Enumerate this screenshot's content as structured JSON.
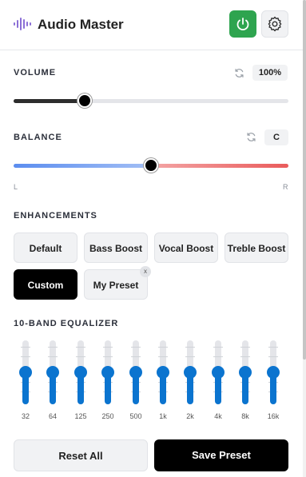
{
  "header": {
    "title": "Audio Master",
    "power_color": "#2ea44f"
  },
  "volume": {
    "label": "VOLUME",
    "value_text": "100%",
    "level": 0.26
  },
  "balance": {
    "label": "BALANCE",
    "value_text": "C",
    "position": 0.5,
    "left_label": "L",
    "right_label": "R"
  },
  "enhancements": {
    "label": "ENHANCEMENTS",
    "presets": [
      "Default",
      "Bass Boost",
      "Vocal Boost",
      "Treble Boost",
      "Custom",
      "My Preset"
    ],
    "active": "Custom",
    "remove_glyph": "x"
  },
  "equalizer": {
    "label": "10-BAND EQUALIZER",
    "bands": [
      {
        "label": "32",
        "gain": 0
      },
      {
        "label": "64",
        "gain": 0
      },
      {
        "label": "125",
        "gain": 0
      },
      {
        "label": "250",
        "gain": 0
      },
      {
        "label": "500",
        "gain": 0
      },
      {
        "label": "1k",
        "gain": 0
      },
      {
        "label": "2k",
        "gain": 0
      },
      {
        "label": "4k",
        "gain": 0
      },
      {
        "label": "8k",
        "gain": 0
      },
      {
        "label": "16k",
        "gain": 0
      }
    ]
  },
  "footer": {
    "reset_label": "Reset All",
    "save_label": "Save Preset"
  },
  "icons": {
    "logo": "soundwave-icon",
    "power": "power-icon",
    "settings": "gear-icon",
    "reset": "refresh-icon",
    "remove": "close-icon"
  },
  "colors": {
    "accent": "#0b74cf",
    "active_preset": "#000000"
  }
}
